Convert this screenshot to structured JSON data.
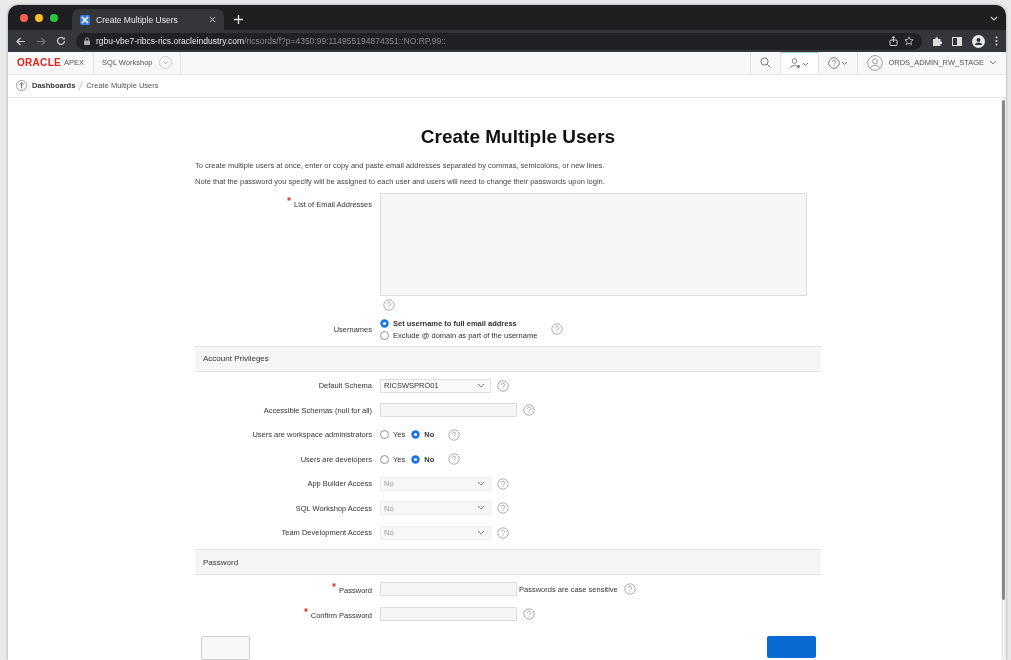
{
  "browser": {
    "tab_title": "Create Multiple Users",
    "url_host": "rgbu-vbe7-ribcs-rics.oracleindustry.com",
    "url_path": "/ricsords/f?p=4350:99:114955194874351::NO:RP,99::"
  },
  "header": {
    "logo": "ORACLE",
    "product": "APEX",
    "menu": "SQL Workshop",
    "user": "ORDS_ADMIN_RW_STAGE"
  },
  "breadcrumb": [
    "Dashboards",
    "Create Multiple Users"
  ],
  "page": {
    "title": "Create Multiple Users",
    "intro": [
      "To create multiple users at once, enter or copy and paste email addresses separated by commas, semicolons, or new lines.",
      "Note that the password you specify will be assigned to each user and users will need to change their passwords upon login."
    ]
  },
  "fields": [
    {
      "kind": "textarea",
      "label": "List of Email Addresses",
      "required": true
    },
    {
      "kind": "radio_stack",
      "label": "Usernames",
      "options": [
        {
          "label": "Set username to full email address",
          "selected": true
        },
        {
          "label": "Exclude @ domain as part of the username",
          "selected": false
        }
      ]
    },
    {
      "kind": "section",
      "label": "Account Privileges"
    },
    {
      "kind": "select",
      "label": "Default Schema",
      "value": "RICSWSPRO01",
      "disabled": false
    },
    {
      "kind": "text",
      "label": "Accessible Schemas (null for all)"
    },
    {
      "kind": "radio_inline",
      "label": "Users are workspace administrators",
      "options": [
        {
          "label": "Yes",
          "selected": false
        },
        {
          "label": "No",
          "selected": true
        }
      ]
    },
    {
      "kind": "radio_inline",
      "label": "Users are developers",
      "options": [
        {
          "label": "Yes",
          "selected": false
        },
        {
          "label": "No",
          "selected": true
        }
      ]
    },
    {
      "kind": "select",
      "label": "App Builder Access",
      "value": "No",
      "disabled": true
    },
    {
      "kind": "select",
      "label": "SQL Workshop Access",
      "value": "No",
      "disabled": true
    },
    {
      "kind": "select",
      "label": "Team Development Access",
      "value": "No",
      "disabled": true
    },
    {
      "kind": "section",
      "label": "Password"
    },
    {
      "kind": "password",
      "label": "Password",
      "required": true,
      "note": "Passwords are case sensitive"
    },
    {
      "kind": "password",
      "label": "Confirm Password",
      "required": true
    }
  ]
}
